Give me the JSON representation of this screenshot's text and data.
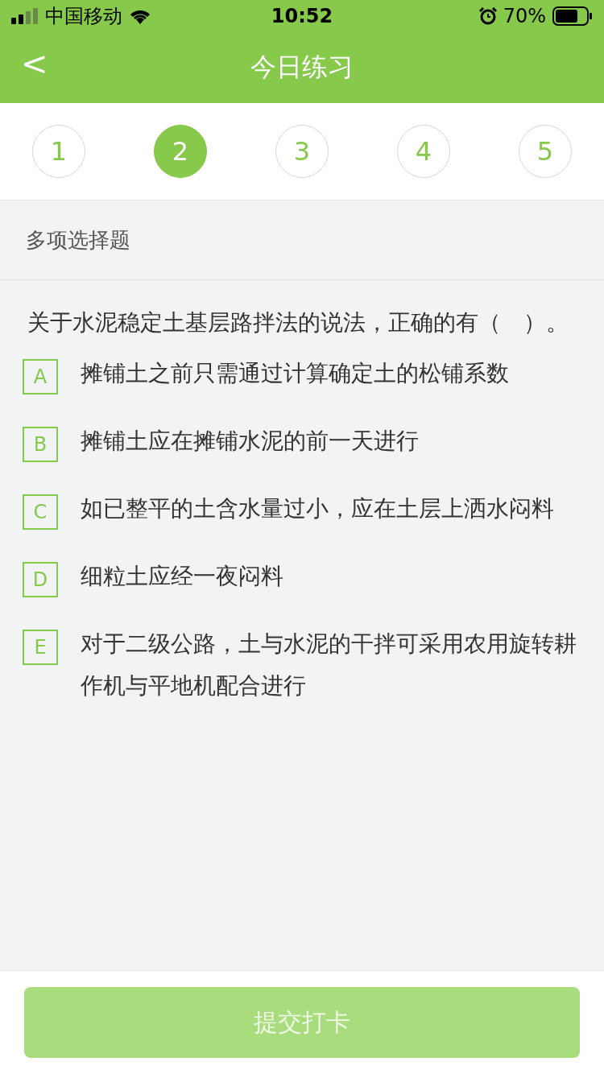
{
  "status_bar": {
    "carrier": "中国移动",
    "time": "10:52",
    "battery": "70%"
  },
  "nav": {
    "back": "<",
    "title": "今日练习"
  },
  "steps": [
    {
      "label": "1",
      "selected": false
    },
    {
      "label": "2",
      "selected": true
    },
    {
      "label": "3",
      "selected": false
    },
    {
      "label": "4",
      "selected": false
    },
    {
      "label": "5",
      "selected": false
    }
  ],
  "question_type": "多项选择题",
  "question": "关于水泥稳定土基层路拌法的说法，正确的有（　）。",
  "options": [
    {
      "letter": "A",
      "text": "摊铺土之前只需通过计算确定土的松铺系数",
      "checked": false
    },
    {
      "letter": "B",
      "text": "摊铺土应在摊铺水泥的前一天进行",
      "checked": false
    },
    {
      "letter": "C",
      "text": "如已整平的土含水量过小，应在土层上洒水闷料",
      "checked": false
    },
    {
      "letter": "D",
      "text": "细粒土应经一夜闷料",
      "checked": false
    },
    {
      "letter": "E",
      "text": "对于二级公路，土与水泥的干拌可采用农用旋转耕作机与平地机配合进行",
      "checked": false
    }
  ],
  "submit": {
    "label": "提交打卡",
    "disabled": true
  }
}
